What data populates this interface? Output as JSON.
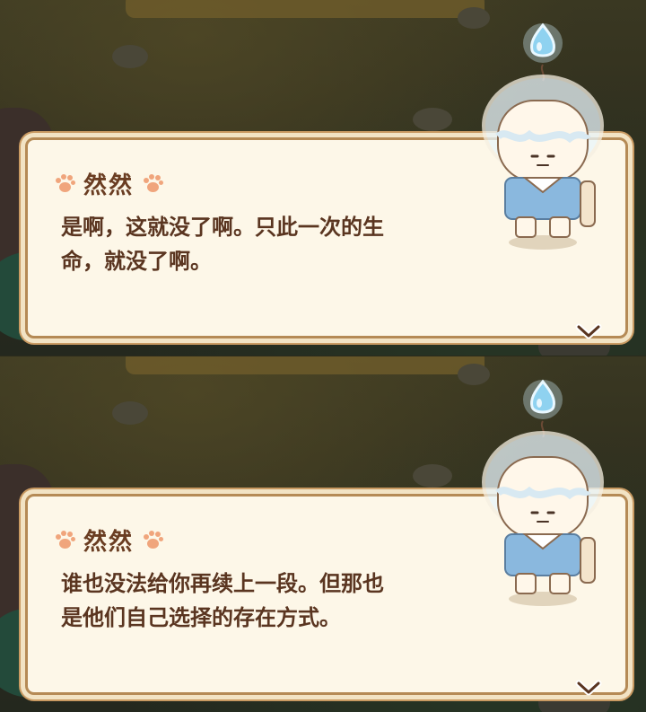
{
  "panels": [
    {
      "speaker": "然然",
      "lines": [
        "是啊，这就没了啊。只此一次的生",
        "命，就没了啊。"
      ]
    },
    {
      "speaker": "然然",
      "lines": [
        "谁也没法给你再续上一段。但那也",
        "是他们自己选择的存在方式。"
      ]
    }
  ],
  "icons": {
    "paw": "paw-print-icon",
    "next": "chevron-down-icon",
    "character": "ghost-character-portrait"
  },
  "colors": {
    "dialog_bg": "#fdf7e8",
    "dialog_border": "#b58a55",
    "text": "#5a3520",
    "paw": "#f0a57c",
    "flame": "#8fd2f0"
  }
}
